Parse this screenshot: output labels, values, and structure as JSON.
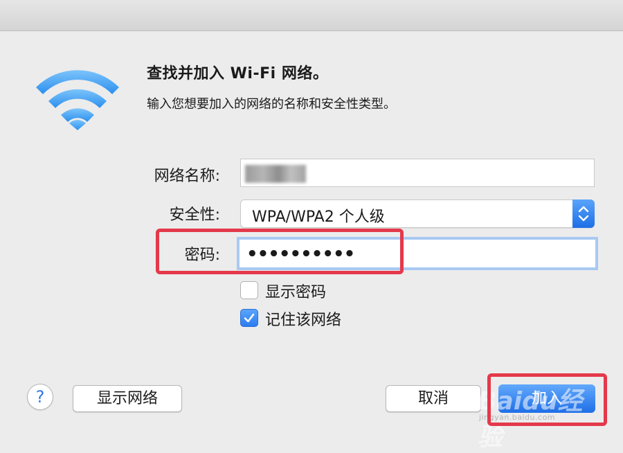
{
  "dialog": {
    "title": "查找并加入 Wi-Fi 网络。",
    "subtitle": "输入您想要加入的网络的名称和安全性类型。"
  },
  "form": {
    "network_name_label": "网络名称:",
    "network_name_value": "",
    "security_label": "安全性:",
    "security_value": "WPA/WPA2 个人级",
    "password_label": "密码:",
    "password_value": "••••••••••"
  },
  "options": {
    "show_password_label": "显示密码",
    "show_password_checked": false,
    "remember_network_label": "记住该网络",
    "remember_network_checked": true
  },
  "buttons": {
    "help": "?",
    "show_networks": "显示网络",
    "cancel": "取消",
    "join": "加入"
  },
  "watermark": {
    "text": "Baidu经验",
    "url": "jingyan.baidu.com"
  },
  "colors": {
    "accent": "#2b7cef",
    "highlight": "#e4394a",
    "focus_ring": "#a8c9f3",
    "wifi_icon": "#4aa8f5"
  },
  "icons": [
    "wifi-icon",
    "stepper-icon",
    "checkmark-icon",
    "help-icon"
  ]
}
